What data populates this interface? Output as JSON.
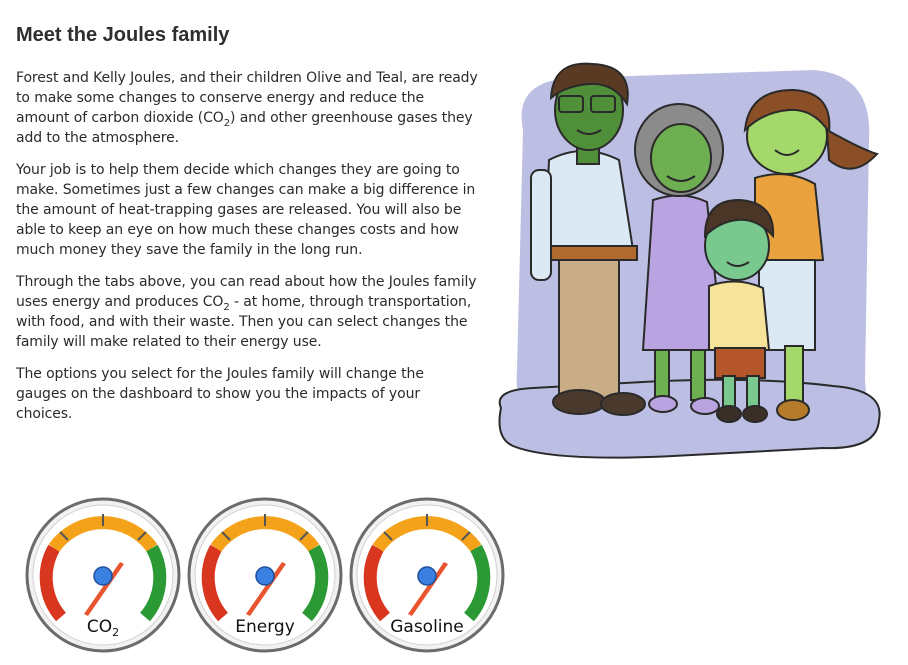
{
  "page": {
    "title": "Meet the Joules family"
  },
  "intro": {
    "p1_a": "Forest and Kelly Joules, and their children Olive and Teal, are ready to make some changes to conserve energy and reduce the amount of carbon dioxide (CO",
    "p1_sub": "2",
    "p1_b": ") and other greenhouse gases they add to the atmosphere.",
    "p2": "Your job is to help them decide which changes they are going to make. Sometimes just a few changes can make a big difference in the amount of heat-trapping gases are released. You will also be able to keep an eye on how much these changes costs and how much money they save the family in the long run.",
    "p3_a": "Through the tabs above, you can read about how the Joules family uses energy and produces CO",
    "p3_sub": "2",
    "p3_b": " - at home, through transportation, with food, and with their waste. Then you can select changes the family will make related to their energy use.",
    "p4": "The options you select for the Joules family will change the gauges on the dashboard to show you the impacts of your choices."
  },
  "gauges": [
    {
      "label_main": "CO",
      "label_sub": "2"
    },
    {
      "label_main": "Energy",
      "label_sub": ""
    },
    {
      "label_main": "Gasoline",
      "label_sub": ""
    }
  ],
  "colors": {
    "gauge_red": "#d9361f",
    "gauge_orange": "#f5a21b",
    "gauge_green": "#2b9a35",
    "needle": "#e8552e",
    "hub": "#3a80e0",
    "backdrop": "#bcbfe3"
  }
}
